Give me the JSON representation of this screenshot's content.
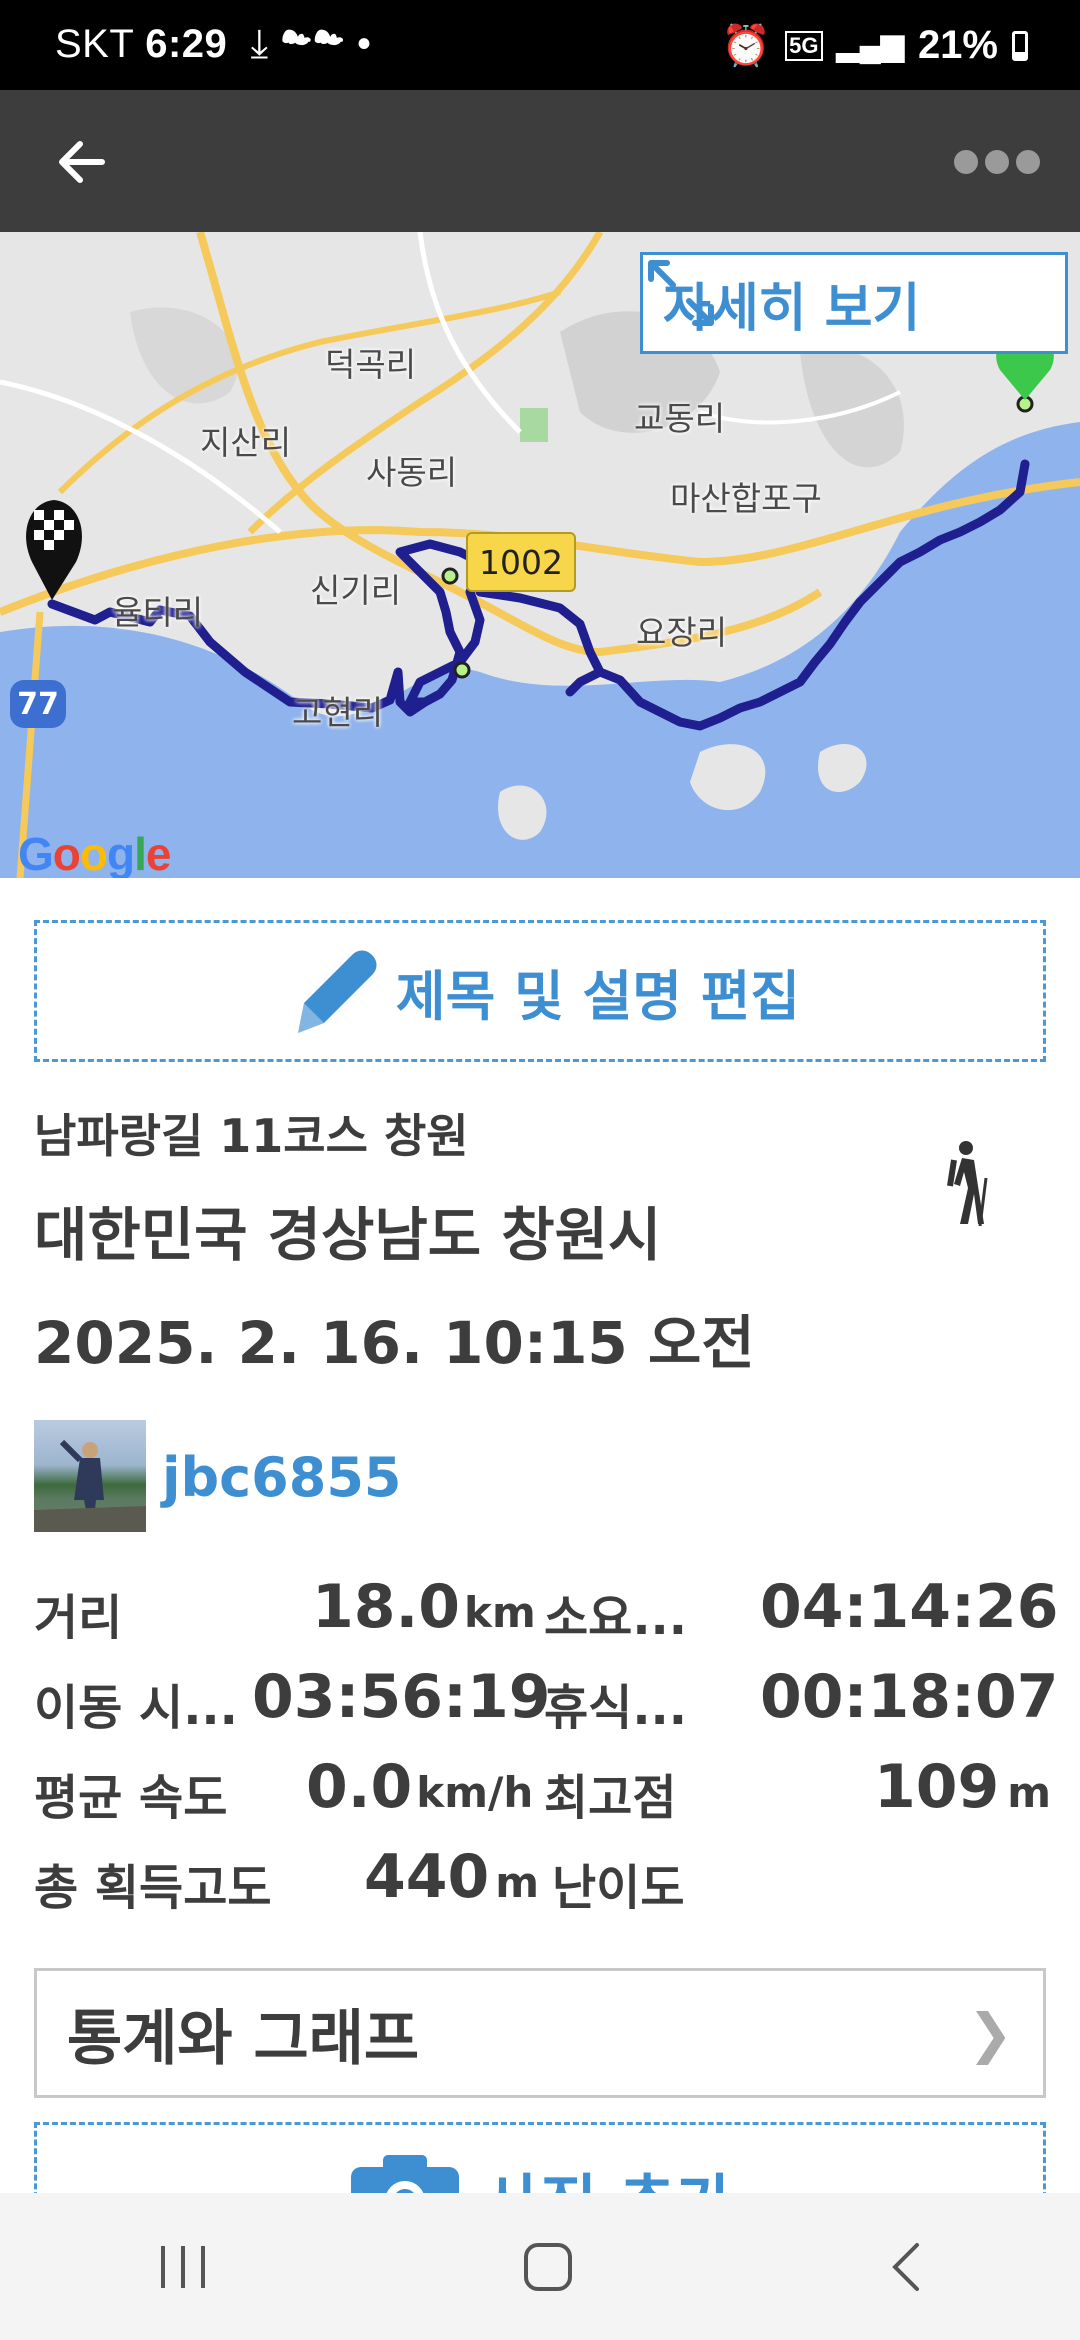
{
  "status_bar": {
    "carrier": "SKT",
    "time": "6:29",
    "network": "5G",
    "battery": "21%"
  },
  "app_bar": {
    "back_icon": "arrow-left-icon",
    "menu_icon": "more-dots-icon"
  },
  "map": {
    "detail_button": "자세히 보기",
    "road_badge": "1002",
    "highway_badge": "77",
    "provider": "Google",
    "labels": {
      "deokgok": "덕곡리",
      "jisan": "지산리",
      "sadong": "사동리",
      "gyodong": "교동리",
      "masan": "마산합포구",
      "singi": "신기리",
      "yultiri": "율티리",
      "yojang": "요장리",
      "gohyeon": "고현리"
    },
    "route_color": "#1f1f8f"
  },
  "content": {
    "edit_button": "제목 및 설명 편집",
    "trail_title": "남파랑길 11코스 창원",
    "location": "대한민국 경상남도 창원시",
    "datetime": "2025. 2. 16. 10:15 오전",
    "username": "jbc6855",
    "activity_icon": "hiking-icon"
  },
  "stats": {
    "distance_label": "거리",
    "distance_value": "18.0",
    "distance_unit": "km",
    "duration_label": "소요...",
    "duration_value": "04:14:26",
    "moving_label": "이동 시...",
    "moving_value": "03:56:19",
    "rest_label": "휴식...",
    "rest_value": "00:18:07",
    "speed_label": "평균 속도",
    "speed_value": "0.0",
    "speed_unit": "km/h",
    "peak_label": "최고점",
    "peak_value": "109",
    "peak_unit": "m",
    "gain_label": "총 획득고도",
    "gain_value": "440",
    "gain_unit": "m",
    "difficulty_label": "난이도"
  },
  "stats_button": "통계와 그래프",
  "photo_button": "사진 추가",
  "accent_color": "#3d8fd1"
}
